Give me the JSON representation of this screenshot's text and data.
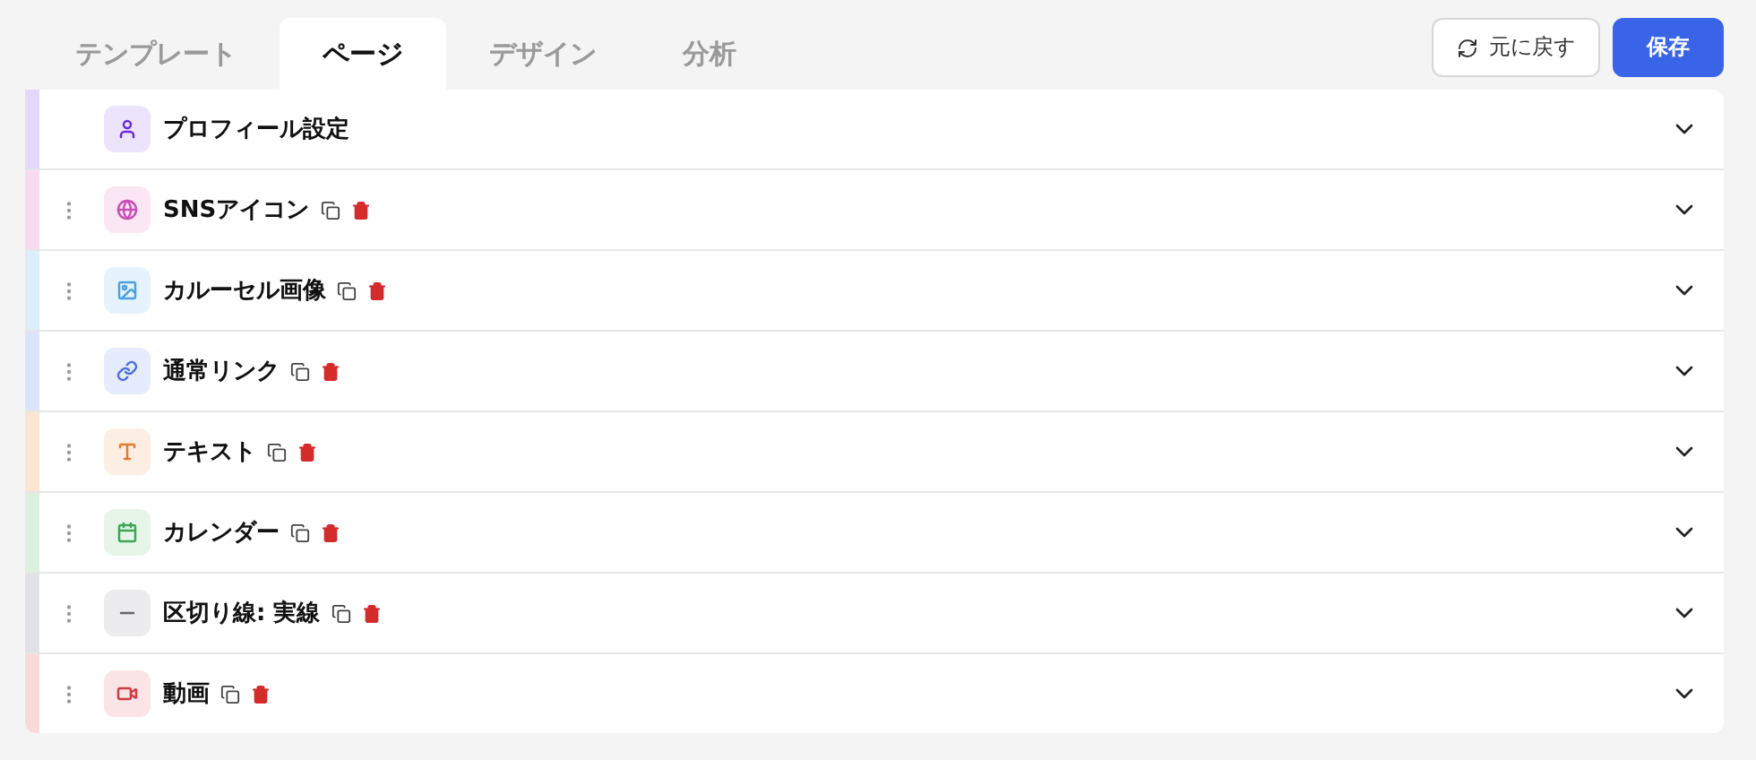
{
  "tabs": [
    {
      "label": "テンプレート",
      "selected": false
    },
    {
      "label": "ページ",
      "selected": true
    },
    {
      "label": "デザイン",
      "selected": false
    },
    {
      "label": "分析",
      "selected": false
    }
  ],
  "actions": {
    "revert": "元に戻す",
    "save": "保存"
  },
  "blocks": [
    {
      "kind": "profile",
      "title": "プロフィール設定",
      "color": "#e4d9fb",
      "removable": false,
      "expanded": false
    },
    {
      "kind": "sns",
      "title": "SNSアイコン",
      "color": "#f8dcee",
      "removable": true,
      "expanded": false
    },
    {
      "kind": "carousel",
      "title": "カルーセル画像",
      "color": "#dcedfb",
      "removable": true,
      "expanded": false
    },
    {
      "kind": "link",
      "title": "通常リンク",
      "color": "#dbe4fb",
      "removable": true,
      "expanded": false
    },
    {
      "kind": "text",
      "title": "テキスト",
      "color": "#fde3d3",
      "removable": true,
      "expanded": false
    },
    {
      "kind": "calendar",
      "title": "カレンダー",
      "color": "#dcf0df",
      "removable": true,
      "expanded": false
    },
    {
      "kind": "divider",
      "title": "区切り線: 実線",
      "color": "#e0e2e7",
      "removable": true,
      "expanded": false
    },
    {
      "kind": "video",
      "title": "動画",
      "color": "#f8dadc",
      "removable": true,
      "expanded": false
    }
  ]
}
